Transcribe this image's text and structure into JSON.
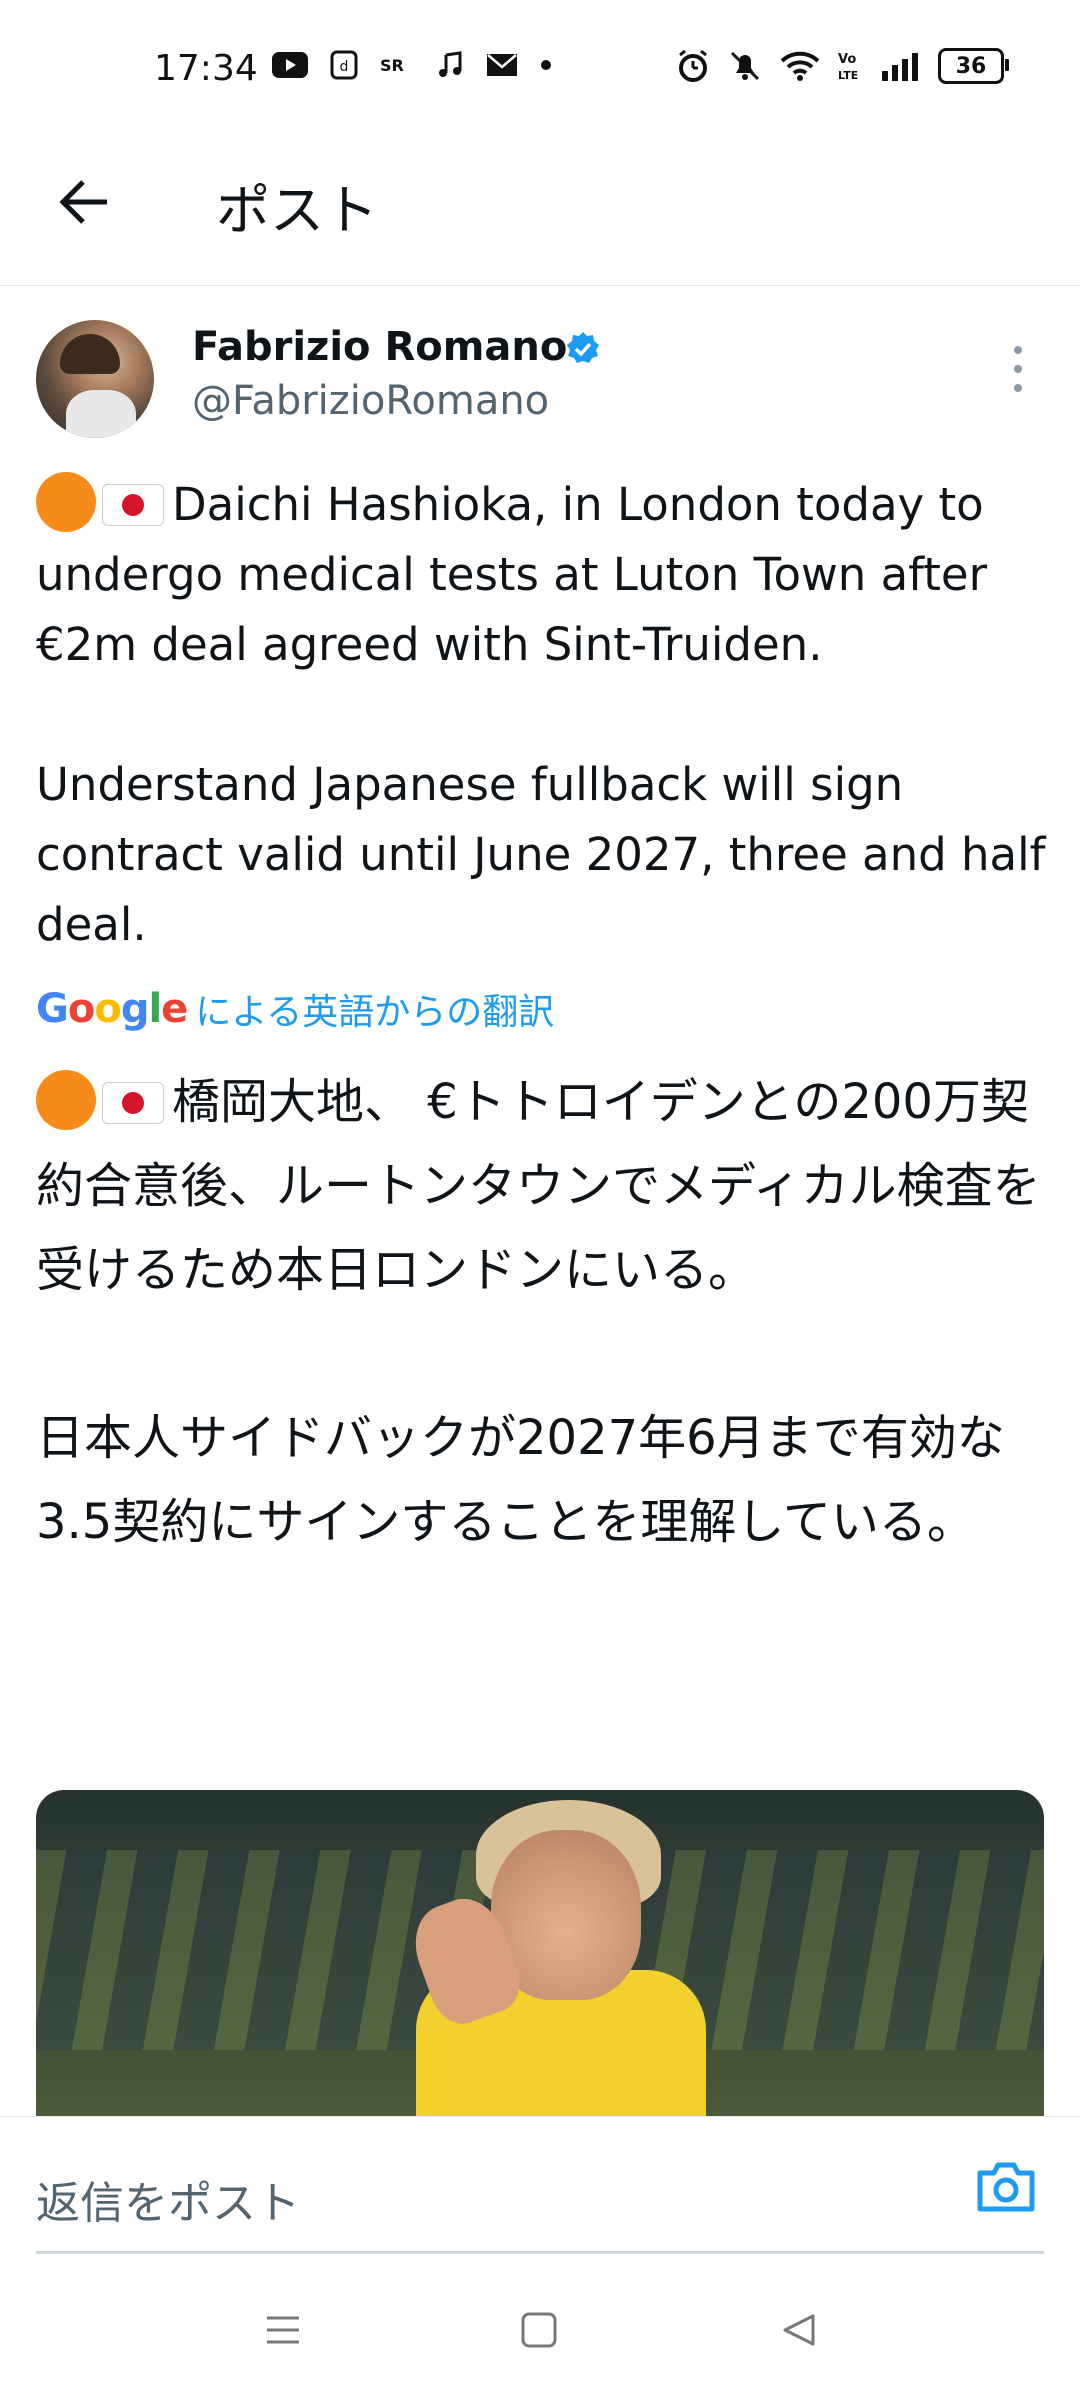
{
  "status_bar": {
    "time": "17:34",
    "left_icons": [
      "youtube-icon",
      "docomo-icon",
      "sports-icon",
      "music-note-icon",
      "mail-icon",
      "dot-icon"
    ],
    "right_icons": [
      "alarm-icon",
      "bell-muted-icon",
      "wifi-icon",
      "volte-icon",
      "signal-icon"
    ],
    "battery": "36"
  },
  "header": {
    "back_icon": "arrow-left-icon",
    "title": "ポスト"
  },
  "post": {
    "author_name": "Fabrizio Romano",
    "author_handle": "@FabrizioRomano",
    "verified_icon": "verified-badge-icon",
    "more_icon": "more-vertical-icon",
    "text_line1": "Daichi Hashioka, in London today to undergo medical tests at Luton Town after €2m deal agreed with Sint-Truiden.",
    "text_para2": "Understand Japanese fullback will sign contract valid until June 2027, three and half deal.",
    "translate": {
      "google_label": "Google",
      "label": "による英語からの翻訳"
    },
    "translated_para1": "橋岡大地、 €トトロイデンとの200万契約合意後、ルートンタウンでメディカル検査を受けるため本日ロンドンにいる。",
    "translated_para2": "日本人サイドバックが2027年6月まで有効な3.5契約にサインすることを理解している。",
    "emoji_flags": [
      "orange-circle",
      "japan-flag"
    ]
  },
  "reply": {
    "placeholder": "返信をポスト",
    "camera_icon": "camera-icon"
  },
  "nav": {
    "icons": [
      "menu-icon",
      "home-square-icon",
      "back-triangle-icon"
    ]
  },
  "colors": {
    "accent": "#1d9bf0",
    "text": "#0f1419",
    "secondary": "#536471"
  }
}
